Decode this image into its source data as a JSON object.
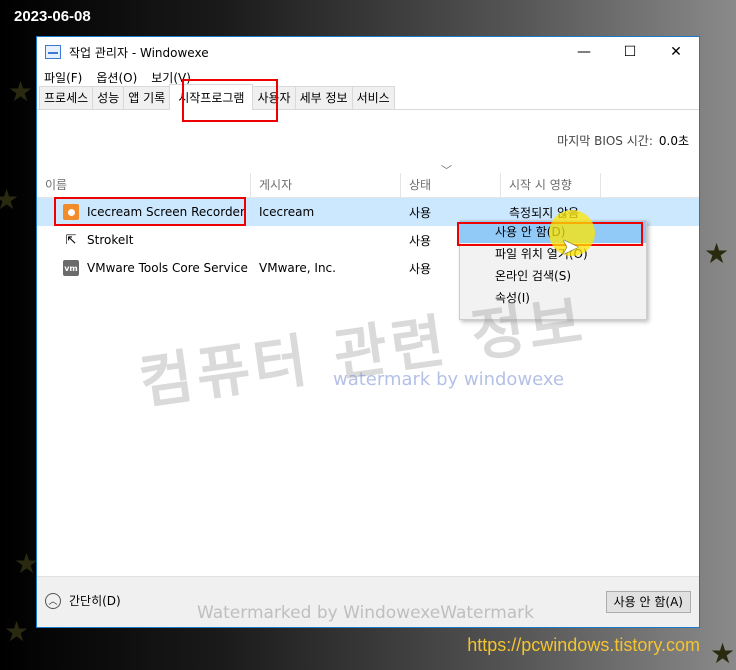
{
  "overlay": {
    "date": "2023-06-08",
    "site_url": "https://pcwindows.tistory.com",
    "watermark_korean": "컴퓨터 관련 정보",
    "watermark_english": "watermark by windowexe",
    "watermark_bottom": "Watermarked by WindowexeWatermark"
  },
  "window": {
    "title": "작업 관리자  - Windowexe",
    "minimize": "—",
    "maximize": "☐",
    "close": "✕"
  },
  "menu": [
    "파일(F)",
    "옵션(O)",
    "보기(V)"
  ],
  "tabs": [
    "프로세스",
    "성능",
    "앱 기록",
    "시작프로그램",
    "사용자",
    "세부 정보",
    "서비스"
  ],
  "active_tab": "시작프로그램",
  "bios": {
    "label": "마지막 BIOS 시간:",
    "value": "0.0초"
  },
  "columns": [
    "이름",
    "게시자",
    "상태",
    "시작 시 영향"
  ],
  "rows": [
    {
      "name": "Icecream Screen Recorder",
      "publisher": "Icecream",
      "status": "사용",
      "impact": "측정되지 않음",
      "icon": "icecream-icon"
    },
    {
      "name": "StrokeIt",
      "publisher": "",
      "status": "사용",
      "impact": "",
      "icon": "strokeit-icon"
    },
    {
      "name": "VMware Tools Core Service",
      "publisher": "VMware, Inc.",
      "status": "사용",
      "impact": "",
      "icon": "vmware-icon"
    }
  ],
  "context_menu": [
    "사용 안 함(D)",
    "파일 위치 열기(O)",
    "온라인 검색(S)",
    "속성(I)"
  ],
  "footer": {
    "fewer_details": "간단히(D)",
    "disable_button": "사용 안 함(A)"
  }
}
